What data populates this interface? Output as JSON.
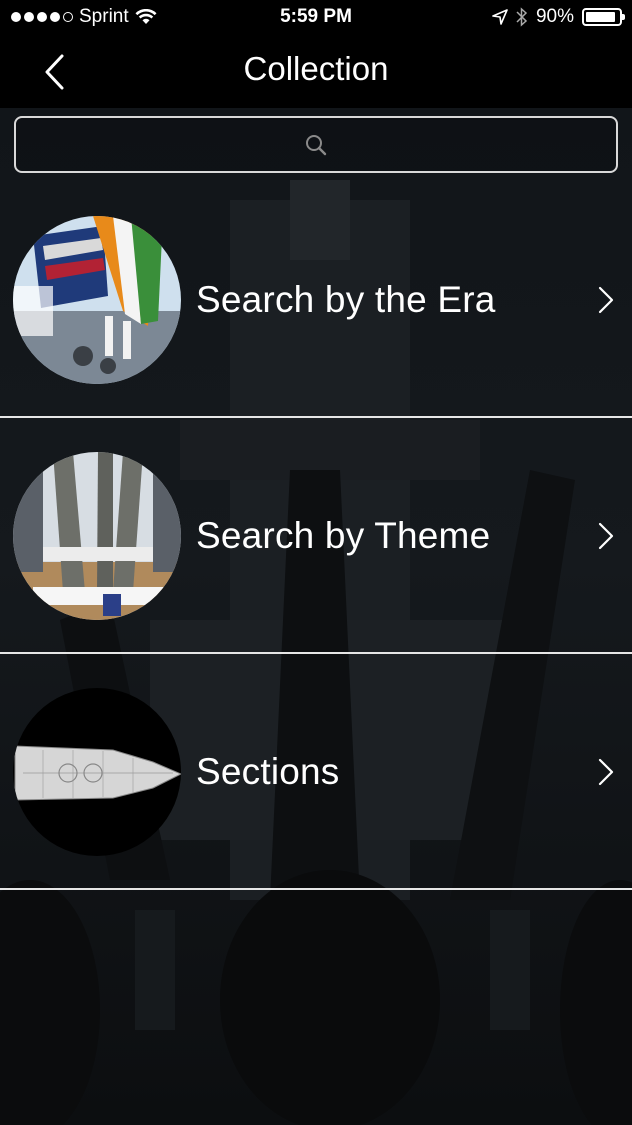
{
  "status_bar": {
    "carrier": "Sprint",
    "time": "5:59 PM",
    "battery_percent": "90%",
    "battery_level": 0.9,
    "signal_bars_filled": 4,
    "signal_bars_total": 5,
    "icons": [
      "wifi-icon",
      "location-arrow-icon",
      "bluetooth-icon",
      "battery-icon"
    ]
  },
  "nav": {
    "title": "Collection",
    "back_icon": "chevron-left-icon"
  },
  "search": {
    "placeholder": "",
    "icon": "search-icon"
  },
  "menu": {
    "items": [
      {
        "label": "Search by the Era",
        "thumbnail": "flags-ship-photo"
      },
      {
        "label": "Search by Theme",
        "thumbnail": "sailors-ceremony-photo"
      },
      {
        "label": "Sections",
        "thumbnail": "ship-plan-diagram"
      }
    ]
  },
  "colors": {
    "background": "#000000",
    "text": "#ffffff",
    "divider": "#e6e6e6",
    "search_border": "#d9d9d9"
  }
}
